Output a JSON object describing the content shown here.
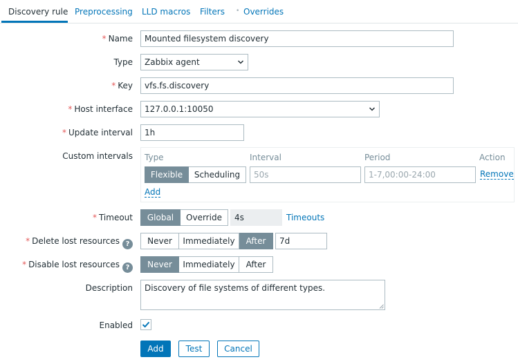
{
  "tabs": {
    "discovery_rule": "Discovery rule",
    "preprocessing": "Preprocessing",
    "lld_macros": "LLD macros",
    "filters": "Filters",
    "overrides": "Overrides"
  },
  "form": {
    "required_mark": "*",
    "name": {
      "label": "Name",
      "value": "Mounted filesystem discovery"
    },
    "type": {
      "label": "Type",
      "value": "Zabbix agent"
    },
    "key": {
      "label": "Key",
      "value": "vfs.fs.discovery"
    },
    "host_interface": {
      "label": "Host interface",
      "value": "127.0.0.1:10050"
    },
    "update_interval": {
      "label": "Update interval",
      "value": "1h"
    },
    "custom_intervals": {
      "label": "Custom intervals",
      "headers": {
        "type": "Type",
        "interval": "Interval",
        "period": "Period",
        "action": "Action"
      },
      "row": {
        "flexible": "Flexible",
        "scheduling": "Scheduling",
        "interval_placeholder": "50s",
        "period_placeholder": "1-7,00:00-24:00",
        "remove": "Remove"
      },
      "add": "Add"
    },
    "timeout": {
      "label": "Timeout",
      "options": [
        "Global",
        "Override"
      ],
      "selected": "Global",
      "value": "4s",
      "link": "Timeouts"
    },
    "delete_lost": {
      "label": "Delete lost resources",
      "help": "?",
      "options": [
        "Never",
        "Immediately",
        "After"
      ],
      "selected": "After",
      "value": "7d"
    },
    "disable_lost": {
      "label": "Disable lost resources",
      "help": "?",
      "options": [
        "Never",
        "Immediately",
        "After"
      ],
      "selected": "Never"
    },
    "description": {
      "label": "Description",
      "value": "Discovery of file systems of different types."
    },
    "enabled": {
      "label": "Enabled",
      "checked": true
    }
  },
  "buttons": {
    "add": "Add",
    "test": "Test",
    "cancel": "Cancel"
  },
  "colors": {
    "accent": "#0275b8",
    "selected_segment": "#768d99",
    "required": "#e45959"
  },
  "icons": {
    "dropdown": "chevron-down-icon",
    "help": "question-circle-icon",
    "checkmark": "check-icon"
  }
}
